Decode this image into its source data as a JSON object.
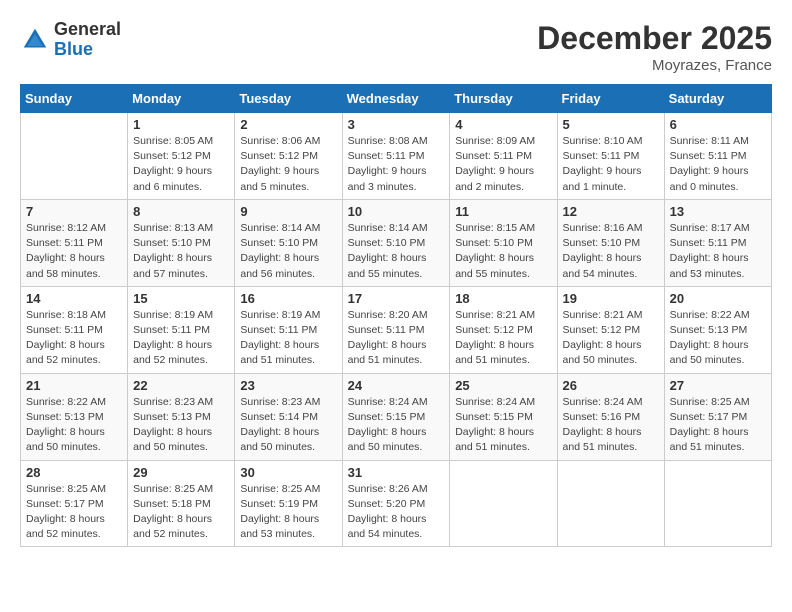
{
  "logo": {
    "general": "General",
    "blue": "Blue"
  },
  "title": "December 2025",
  "location": "Moyrazes, France",
  "days_of_week": [
    "Sunday",
    "Monday",
    "Tuesday",
    "Wednesday",
    "Thursday",
    "Friday",
    "Saturday"
  ],
  "weeks": [
    [
      {
        "day": "",
        "sunrise": "",
        "sunset": "",
        "daylight": ""
      },
      {
        "day": "1",
        "sunrise": "8:05 AM",
        "sunset": "5:12 PM",
        "daylight": "9 hours and 6 minutes."
      },
      {
        "day": "2",
        "sunrise": "8:06 AM",
        "sunset": "5:12 PM",
        "daylight": "9 hours and 5 minutes."
      },
      {
        "day": "3",
        "sunrise": "8:08 AM",
        "sunset": "5:11 PM",
        "daylight": "9 hours and 3 minutes."
      },
      {
        "day": "4",
        "sunrise": "8:09 AM",
        "sunset": "5:11 PM",
        "daylight": "9 hours and 2 minutes."
      },
      {
        "day": "5",
        "sunrise": "8:10 AM",
        "sunset": "5:11 PM",
        "daylight": "9 hours and 1 minute."
      },
      {
        "day": "6",
        "sunrise": "8:11 AM",
        "sunset": "5:11 PM",
        "daylight": "9 hours and 0 minutes."
      }
    ],
    [
      {
        "day": "7",
        "sunrise": "8:12 AM",
        "sunset": "5:11 PM",
        "daylight": "8 hours and 58 minutes."
      },
      {
        "day": "8",
        "sunrise": "8:13 AM",
        "sunset": "5:10 PM",
        "daylight": "8 hours and 57 minutes."
      },
      {
        "day": "9",
        "sunrise": "8:14 AM",
        "sunset": "5:10 PM",
        "daylight": "8 hours and 56 minutes."
      },
      {
        "day": "10",
        "sunrise": "8:14 AM",
        "sunset": "5:10 PM",
        "daylight": "8 hours and 55 minutes."
      },
      {
        "day": "11",
        "sunrise": "8:15 AM",
        "sunset": "5:10 PM",
        "daylight": "8 hours and 55 minutes."
      },
      {
        "day": "12",
        "sunrise": "8:16 AM",
        "sunset": "5:10 PM",
        "daylight": "8 hours and 54 minutes."
      },
      {
        "day": "13",
        "sunrise": "8:17 AM",
        "sunset": "5:11 PM",
        "daylight": "8 hours and 53 minutes."
      }
    ],
    [
      {
        "day": "14",
        "sunrise": "8:18 AM",
        "sunset": "5:11 PM",
        "daylight": "8 hours and 52 minutes."
      },
      {
        "day": "15",
        "sunrise": "8:19 AM",
        "sunset": "5:11 PM",
        "daylight": "8 hours and 52 minutes."
      },
      {
        "day": "16",
        "sunrise": "8:19 AM",
        "sunset": "5:11 PM",
        "daylight": "8 hours and 51 minutes."
      },
      {
        "day": "17",
        "sunrise": "8:20 AM",
        "sunset": "5:11 PM",
        "daylight": "8 hours and 51 minutes."
      },
      {
        "day": "18",
        "sunrise": "8:21 AM",
        "sunset": "5:12 PM",
        "daylight": "8 hours and 51 minutes."
      },
      {
        "day": "19",
        "sunrise": "8:21 AM",
        "sunset": "5:12 PM",
        "daylight": "8 hours and 50 minutes."
      },
      {
        "day": "20",
        "sunrise": "8:22 AM",
        "sunset": "5:13 PM",
        "daylight": "8 hours and 50 minutes."
      }
    ],
    [
      {
        "day": "21",
        "sunrise": "8:22 AM",
        "sunset": "5:13 PM",
        "daylight": "8 hours and 50 minutes."
      },
      {
        "day": "22",
        "sunrise": "8:23 AM",
        "sunset": "5:13 PM",
        "daylight": "8 hours and 50 minutes."
      },
      {
        "day": "23",
        "sunrise": "8:23 AM",
        "sunset": "5:14 PM",
        "daylight": "8 hours and 50 minutes."
      },
      {
        "day": "24",
        "sunrise": "8:24 AM",
        "sunset": "5:15 PM",
        "daylight": "8 hours and 50 minutes."
      },
      {
        "day": "25",
        "sunrise": "8:24 AM",
        "sunset": "5:15 PM",
        "daylight": "8 hours and 51 minutes."
      },
      {
        "day": "26",
        "sunrise": "8:24 AM",
        "sunset": "5:16 PM",
        "daylight": "8 hours and 51 minutes."
      },
      {
        "day": "27",
        "sunrise": "8:25 AM",
        "sunset": "5:17 PM",
        "daylight": "8 hours and 51 minutes."
      }
    ],
    [
      {
        "day": "28",
        "sunrise": "8:25 AM",
        "sunset": "5:17 PM",
        "daylight": "8 hours and 52 minutes."
      },
      {
        "day": "29",
        "sunrise": "8:25 AM",
        "sunset": "5:18 PM",
        "daylight": "8 hours and 52 minutes."
      },
      {
        "day": "30",
        "sunrise": "8:25 AM",
        "sunset": "5:19 PM",
        "daylight": "8 hours and 53 minutes."
      },
      {
        "day": "31",
        "sunrise": "8:26 AM",
        "sunset": "5:20 PM",
        "daylight": "8 hours and 54 minutes."
      },
      {
        "day": "",
        "sunrise": "",
        "sunset": "",
        "daylight": ""
      },
      {
        "day": "",
        "sunrise": "",
        "sunset": "",
        "daylight": ""
      },
      {
        "day": "",
        "sunrise": "",
        "sunset": "",
        "daylight": ""
      }
    ]
  ]
}
